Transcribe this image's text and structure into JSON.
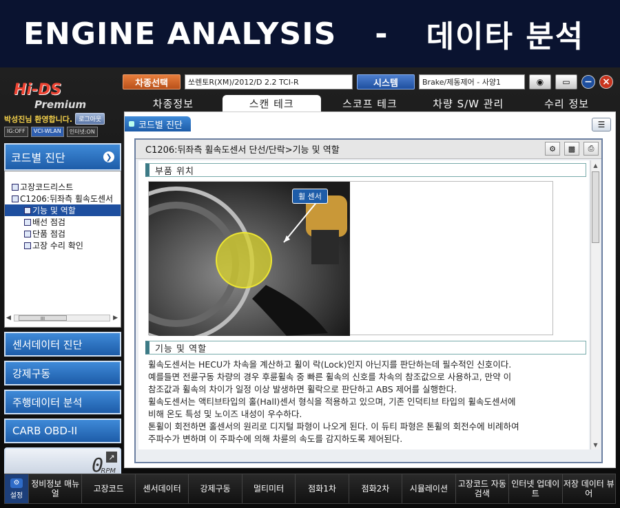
{
  "banner": {
    "title_en": "ENGINE ANALYSIS",
    "dash": "-",
    "title_ko": "데이타 분석"
  },
  "logo": {
    "brand": "Hi-DS",
    "edition": "Premium"
  },
  "user": {
    "welcome": "박성진님 환영합니다.",
    "logout": "로그아웃"
  },
  "status": {
    "ig": "IG:OFF",
    "vci": "VCI-WLAN",
    "net": "인터넷:ON"
  },
  "toolbar": {
    "vehicle_btn": "차종선택",
    "vehicle_value": "쏘렌토R(XM)/2012/D 2.2 TCI-R",
    "system_btn": "시스템",
    "system_value": "Brake/제동제어 - 사양1"
  },
  "tabs": [
    "차종정보",
    "스캔 테크",
    "스코프 테크",
    "차량 S/W 관리",
    "수리 정보"
  ],
  "sidebar": {
    "header": "코드별 진단",
    "tree": [
      {
        "label": "고장코드리스트",
        "level": 0
      },
      {
        "label": "C1206:뒤좌측 휠속도센서",
        "level": 0
      },
      {
        "label": "기능 및 역할",
        "level": 1,
        "selected": true
      },
      {
        "label": "배선 점검",
        "level": 1
      },
      {
        "label": "단품 점검",
        "level": 1
      },
      {
        "label": "고장 수리 확인",
        "level": 1
      }
    ],
    "scroll_label": "III",
    "nav": [
      "센서데이터 진단",
      "강제구동",
      "주행데이터 분석",
      "CARB OBD-II"
    ],
    "rpm_value": "0",
    "rpm_unit": "RPM"
  },
  "main": {
    "caption": "코드별 진단",
    "title": "C1206:뒤좌측 휠속도센서 단선/단락>기능 및 역할",
    "section1": "부품 위치",
    "photo_label": "휠 센서",
    "section2": "기능 및 역할",
    "paragraphs": [
      "휠속도센서는 HECU가 차속을 계산하고 휠이 락(Lock)인지 아닌지를 판단하는데 필수적인 신호이다.",
      "예를들면 전륜구동 차량의 경우 후륜휠속 중 빠른 휠속의 신호를 차속의 참조값으로 사용하고, 만약 이",
      "참조값과 휠속의 차이가 일정 이상 발생하면 휠락으로 판단하고 ABS 제어를 실행한다.",
      "휠속도센서는 액티브타입의 홀(Hall)센서 형식을 적용하고 있으며, 기존 인덕티브 타입의 휠속도센서에",
      "비해 온도 특성 및 노이즈 내성이 우수하다.",
      "톤휠이 회전하면 홀센서의 원리로 디지털 파형이 나오게 된다. 이 듀티 파형은 톤휠의 회전수에 비례하여",
      "주파수가 변하며 이 주파수에 의해 차륜의 속도를 감지하도록 제어된다."
    ]
  },
  "bottom": {
    "settings": "설정",
    "buttons": [
      "정비정보 매뉴얼",
      "고장코드",
      "센서데이터",
      "강제구동",
      "멀티미터",
      "점화1차",
      "점화2차",
      "시뮬레이션",
      "고장코드 자동검색",
      "인터넷 업데이트",
      "저장 데이터 뷰어"
    ]
  },
  "colors": {
    "accent": "#1d5ca8",
    "orange": "#c9622a",
    "banner": "#0a1330"
  }
}
